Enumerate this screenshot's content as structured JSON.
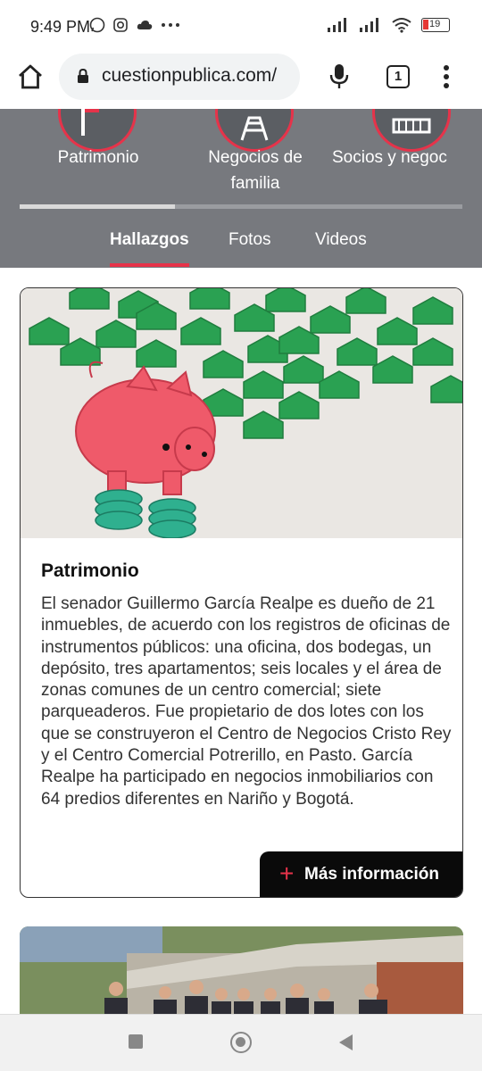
{
  "status": {
    "time": "9:49 PM",
    "battery": "19"
  },
  "browser": {
    "url": "cuestionpublica.com/",
    "tab_count": "1"
  },
  "categories": [
    {
      "label": "Patrimonio"
    },
    {
      "label": "Negocios de familia"
    },
    {
      "label": "Socios y negoc"
    }
  ],
  "carousel": {
    "progress": 0.35
  },
  "subtabs": [
    {
      "label": "Hallazgos",
      "active": true
    },
    {
      "label": "Fotos",
      "active": false
    },
    {
      "label": "Videos",
      "active": false
    }
  ],
  "card": {
    "title": "Patrimonio",
    "text": "El senador Guillermo García Realpe es dueño de 21 inmuebles, de acuerdo con los registros de oficinas de instrumentos públicos: una oficina, dos bodegas, un depósito, tres apartamentos; seis locales y el área de zonas comunes de un centro comercial; siete parqueaderos. Fue propietario de dos lotes con los que se construyeron el Centro de Negocios Cristo Rey y el Centro Comercial Potrerillo, en Pasto. García Realpe ha participado en negocios inmobiliarios con 64 predios diferentes en Nariño y Bogotá.",
    "more_label": "Más información"
  },
  "colors": {
    "accent": "#e6334a",
    "band": "#77797e",
    "button_bg": "#0a0a0a"
  }
}
